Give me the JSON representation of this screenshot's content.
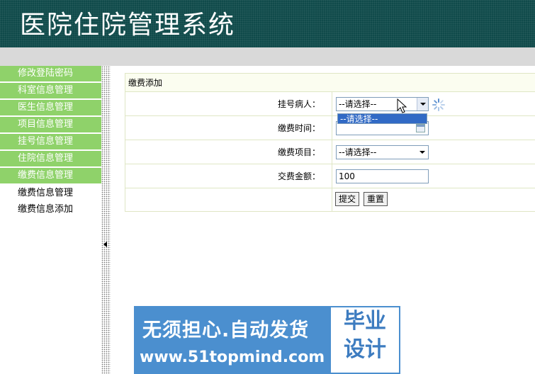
{
  "header": {
    "title": "医院住院管理系统"
  },
  "sidebar": {
    "menu": [
      {
        "label": "修改登陆密码"
      },
      {
        "label": "科室信息管理"
      },
      {
        "label": "医生信息管理"
      },
      {
        "label": "项目信息管理"
      },
      {
        "label": "挂号信息管理"
      },
      {
        "label": "住院信息管理"
      },
      {
        "label": "缴费信息管理"
      }
    ],
    "submenu": [
      {
        "label": "缴费信息管理"
      },
      {
        "label": "缴费信息添加"
      }
    ]
  },
  "form": {
    "title": "缴费添加",
    "fields": {
      "patient": {
        "label": "挂号病人：",
        "value": "--请选择--",
        "dropdown_option": "--请选择--"
      },
      "time": {
        "label": "缴费时间：",
        "value": ""
      },
      "item": {
        "label": "缴费项目：",
        "value": "--请选择--"
      },
      "amount": {
        "label": "交费金额：",
        "value": "100"
      }
    },
    "buttons": {
      "submit": "提交",
      "reset": "重置"
    }
  },
  "banner": {
    "slogan": "无须担心.自动发货",
    "url": "www.51topmind.com",
    "badge_line1": "毕业",
    "badge_line2": "设计"
  },
  "icons": {
    "cursor": "mouse-pointer-icon",
    "spinner": "loading-spinner-icon",
    "calendar": "calendar-icon",
    "collapse": "collapse-arrow-icon"
  },
  "colors": {
    "header_bg": "#0f4a4a",
    "menu_bg": "#8fd26a",
    "banner_bg": "#4b8fcf",
    "selected_option": "#316ac5"
  }
}
